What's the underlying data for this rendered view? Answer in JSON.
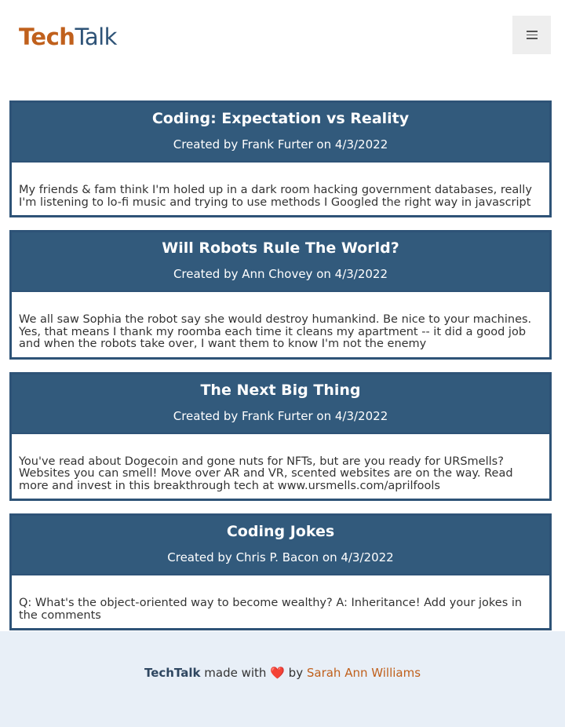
{
  "header": {
    "logo_part1": "Tech",
    "logo_part2": "Talk",
    "menu_icon": "hamburger-icon"
  },
  "posts": [
    {
      "title": "Coding: Expectation vs Reality",
      "meta": "Created by Frank Furter on 4/3/2022",
      "body": "My friends & fam think I'm holed up in a dark room hacking government databases, really I'm listening to lo-fi music and trying to use methods I Googled the right way in javascript"
    },
    {
      "title": "Will Robots Rule The World?",
      "meta": "Created by Ann Chovey on 4/3/2022",
      "body": "We all saw Sophia the robot say she would destroy humankind. Be nice to your machines. Yes, that means I thank my roomba each time it cleans my apartment -- it did a good job and when the robots take over, I want them to know I'm not the enemy"
    },
    {
      "title": "The Next Big Thing",
      "meta": "Created by Frank Furter on 4/3/2022",
      "body": "You've read about Dogecoin and gone nuts for NFTs, but are you ready for URSmells? Websites you can smell! Move over AR and VR, scented websites are on the way. Read more and invest in this breakthrough tech at www.ursmells.com/aprilfools"
    },
    {
      "title": "Coding Jokes",
      "meta": "Created by Chris P. Bacon on 4/3/2022",
      "body": "Q: What's the object-oriented way to become wealthy? A: Inheritance! Add your jokes in the comments"
    }
  ],
  "footer": {
    "brand": "TechTalk",
    "made_with": "made with",
    "heart": "❤️",
    "by": "by",
    "author": "Sarah Ann Williams",
    "heart_icon": "heart-icon"
  },
  "colors": {
    "accent_orange": "#c0601c",
    "brand_blue": "#2e5377",
    "footer_bg": "#e8eff7"
  }
}
